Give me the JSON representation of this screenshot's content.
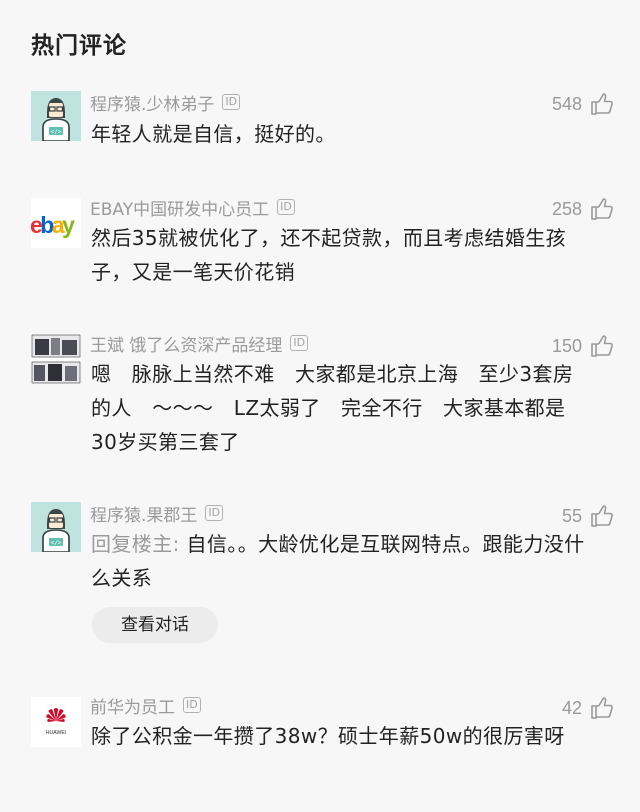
{
  "section": {
    "title": "热门评论"
  },
  "comments": [
    {
      "author": "程序猿.少林弟子",
      "badge": "ID",
      "likes": "548",
      "text": "年轻人就是自信，挺好的。",
      "avatar": "programmer-avatar"
    },
    {
      "author": "EBAY中国研发中心员工",
      "badge": "ID",
      "likes": "258",
      "text": "然后35就被优化了，还不起贷款，而且考虑结婚生孩子，又是一笔天价花销",
      "avatar": "ebay-logo",
      "logo_letters": [
        "e",
        "b",
        "a",
        "y"
      ],
      "logo_colors": [
        "#e53238",
        "#0064d2",
        "#f5af02",
        "#86b817"
      ]
    },
    {
      "author": "王斌 饿了么资深产品经理",
      "badge": "ID",
      "likes": "150",
      "text": "嗯　脉脉上当然不难　大家都是北京上海　至少3套房的人　～～～　LZ太弱了　完全不行　大家基本都是30岁买第三套了",
      "avatar": "photo-collage-avatar"
    },
    {
      "author": "程序猿.果郡王",
      "badge": "ID",
      "likes": "55",
      "reply_prefix": "回复楼主:",
      "text": "自信。。大龄优化是互联网特点。跟能力没什么关系",
      "avatar": "programmer-avatar",
      "action_label": "查看对话"
    },
    {
      "author": "前华为员工",
      "badge": "ID",
      "likes": "42",
      "text": "除了公积金一年攒了38w？硕士年薪50w的很厉害呀",
      "avatar": "huawei-logo",
      "logo_text": "HUAWEI"
    }
  ],
  "colors": {
    "background": "#f7f7f7",
    "muted_text": "#9a9a9a",
    "body_text": "#222222",
    "avatar_teal": "#bfe3df",
    "huawei_red": "#cf0a2c"
  }
}
